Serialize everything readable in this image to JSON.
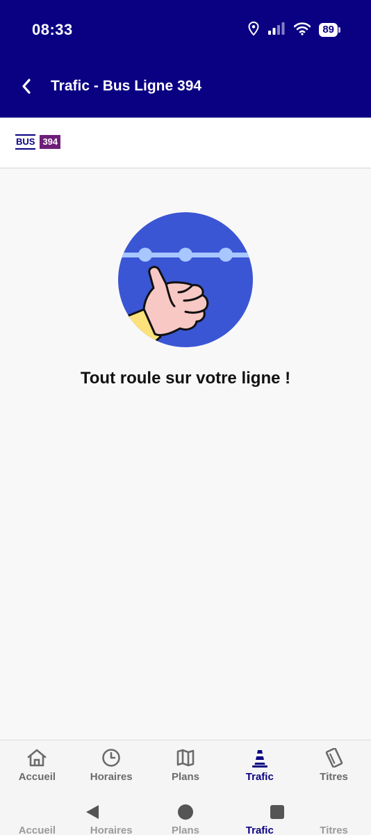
{
  "status_bar": {
    "time": "08:33",
    "battery": "89"
  },
  "app_bar": {
    "title": "Trafic - Bus Ligne 394"
  },
  "line": {
    "mode": "BUS",
    "number": "394",
    "number_color": "#6e1e78"
  },
  "content": {
    "message": "Tout roule sur votre ligne !"
  },
  "bottom_nav": {
    "items": [
      {
        "label": "Accueil",
        "icon": "home-icon"
      },
      {
        "label": "Horaires",
        "icon": "clock-icon"
      },
      {
        "label": "Plans",
        "icon": "map-icon"
      },
      {
        "label": "Trafic",
        "icon": "traffic-cone-icon",
        "active": true
      },
      {
        "label": "Titres",
        "icon": "ticket-icon"
      }
    ]
  },
  "colors": {
    "primary": "#0a0082",
    "background": "#f8f8f8",
    "illustration_blue": "#3a56d4"
  }
}
